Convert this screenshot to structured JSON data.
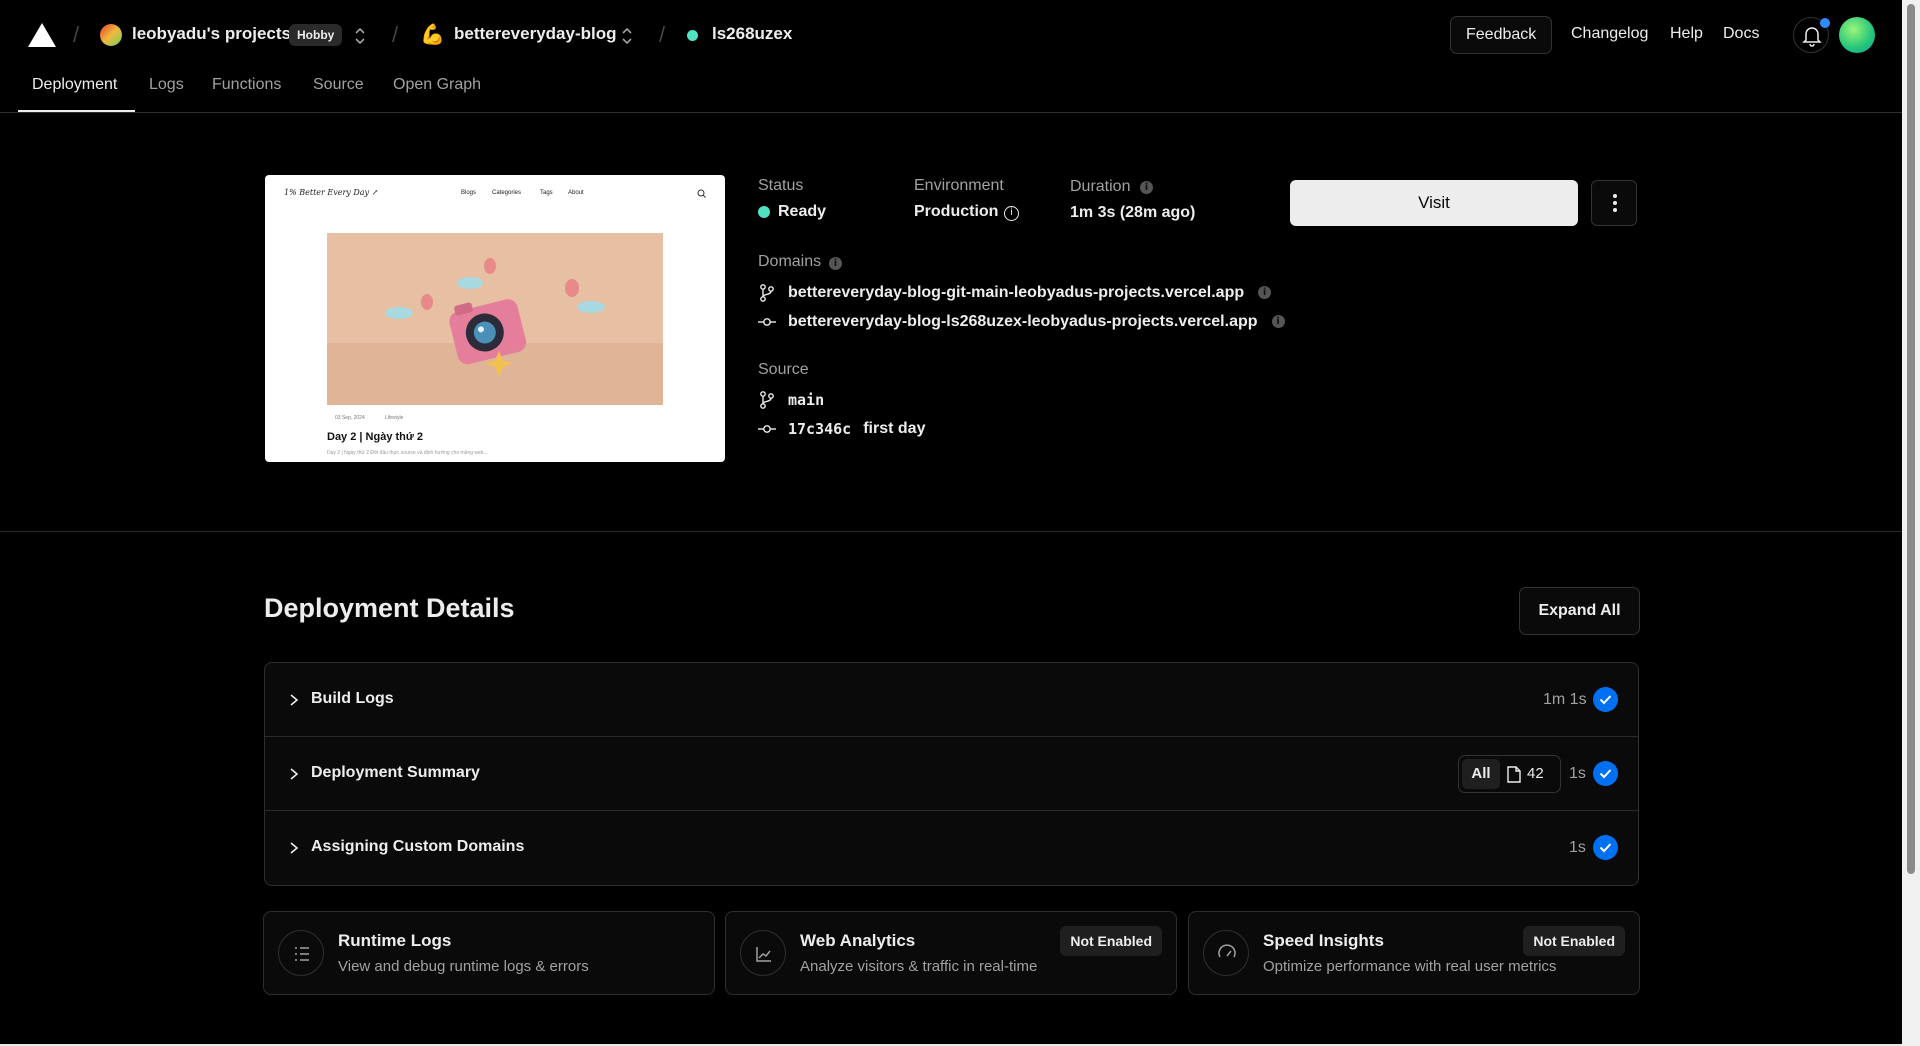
{
  "topbar": {
    "team": "leobyadu's projects",
    "plan_badge": "Hobby",
    "project_emoji": "💪",
    "project": "bettereveryday-blog",
    "deployment_id": "ls268uzex",
    "feedback": "Feedback",
    "changelog": "Changelog",
    "help": "Help",
    "docs": "Docs"
  },
  "tabs": [
    "Deployment",
    "Logs",
    "Functions",
    "Source",
    "Open Graph"
  ],
  "preview": {
    "site_title": "1% Better Every Day ↗",
    "nav": [
      "Blogs",
      "Categories",
      "Tags",
      "About"
    ],
    "post_meta_date": "03 Sep, 2024",
    "post_meta_cat": "Lifestyle",
    "post_title": "Day 2 | Ngày thứ 2",
    "post_excerpt": "Day 2 | Ngày thứ 2 Đời đầu thực source và định hướng cho mảng web..."
  },
  "deployment": {
    "status_label": "Status",
    "status_value": "Ready",
    "environment_label": "Environment",
    "environment_value": "Production",
    "duration_label": "Duration",
    "duration_value": "1m 3s (28m ago)",
    "domains_label": "Domains",
    "domains": [
      "bettereveryday-blog-git-main-leobyadus-projects.vercel.app",
      "bettereveryday-blog-ls268uzex-leobyadus-projects.vercel.app"
    ],
    "source_label": "Source",
    "branch": "main",
    "commit_hash": "17c346c",
    "commit_message": "first day",
    "visit": "Visit"
  },
  "details": {
    "title": "Deployment Details",
    "expand_all": "Expand All",
    "rows": [
      {
        "name": "Build Logs",
        "duration": "1m 1s"
      },
      {
        "name": "Deployment Summary",
        "duration": "1s",
        "filter": "All",
        "file_count": "42"
      },
      {
        "name": "Assigning Custom Domains",
        "duration": "1s"
      }
    ]
  },
  "cards": [
    {
      "title": "Runtime Logs",
      "desc": "View and debug runtime logs & errors",
      "badge": ""
    },
    {
      "title": "Web Analytics",
      "desc": "Analyze visitors & traffic in real-time",
      "badge": "Not Enabled"
    },
    {
      "title": "Speed Insights",
      "desc": "Optimize performance with real user metrics",
      "badge": "Not Enabled"
    }
  ],
  "colors": {
    "accent_blue": "#0070f3",
    "ready_green": "#50e3c2"
  }
}
